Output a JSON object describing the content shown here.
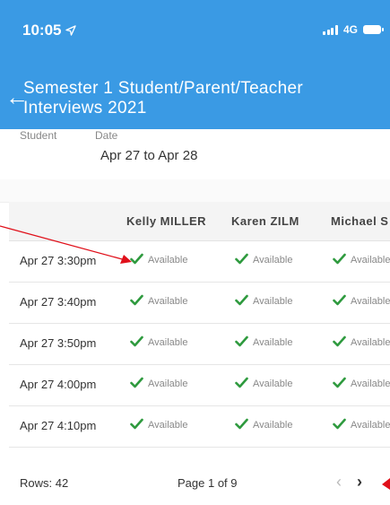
{
  "status_bar": {
    "time": "10:05",
    "network": "4G",
    "icons": [
      "location-arrow-icon",
      "signal-bars-icon",
      "battery-icon"
    ]
  },
  "header": {
    "title": "Semester 1 Student/Parent/Teacher Interviews 2021",
    "back_icon": "back-arrow-icon",
    "color": "#3a9ae4"
  },
  "info": {
    "student_label": "Student",
    "date_label": "Date",
    "date_value": "Apr 27 to Apr 28"
  },
  "table": {
    "columns": [
      "",
      "Kelly MILLER",
      "Karen ZILM",
      "Michael S"
    ],
    "rows": [
      {
        "time": "Apr 27 3:30pm",
        "cells": [
          "Available",
          "Available",
          "Available"
        ]
      },
      {
        "time": "Apr 27 3:40pm",
        "cells": [
          "Available",
          "Available",
          "Available"
        ]
      },
      {
        "time": "Apr 27 3:50pm",
        "cells": [
          "Available",
          "Available",
          "Available"
        ]
      },
      {
        "time": "Apr 27 4:00pm",
        "cells": [
          "Available",
          "Available",
          "Available"
        ]
      },
      {
        "time": "Apr 27 4:10pm",
        "cells": [
          "Available",
          "Available",
          "Available"
        ]
      }
    ],
    "available_color": "#2e9a3e"
  },
  "pagination": {
    "rows_label": "Rows: 42",
    "page_label": "Page 1 of 9",
    "prev_icon": "chevron-left-icon",
    "next_icon": "chevron-right-icon"
  },
  "annotations": {
    "arrow_color": "#e0101a"
  }
}
